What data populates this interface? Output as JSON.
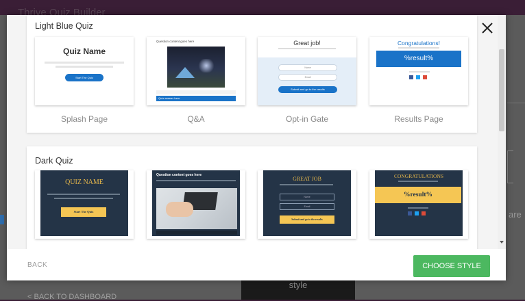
{
  "background": {
    "app_title": "Thrive Quiz Builder",
    "secondary_button": "style",
    "back_to_dashboard": "< BACK TO DASHBOARD",
    "right_partial_text": "are"
  },
  "modal": {
    "close_icon": "close-icon",
    "sections": [
      {
        "title": "Light Blue Quiz",
        "cards": [
          {
            "label": "Splash Page",
            "preview_title": "Quiz Name",
            "preview_button": "Start The Quiz"
          },
          {
            "label": "Q&A",
            "preview_question": "Question content goes here",
            "preview_answer": "Quiz answer here"
          },
          {
            "label": "Opt-in Gate",
            "preview_title": "Great job!",
            "preview_field1": "Name",
            "preview_field2": "Email",
            "preview_button": "Submit and go to the results"
          },
          {
            "label": "Results Page",
            "preview_title": "Congratulations!",
            "preview_result": "%result%"
          }
        ]
      },
      {
        "title": "Dark Quiz",
        "cards": [
          {
            "label": "",
            "preview_title": "QUIZ NAME",
            "preview_button": "Start The Quiz"
          },
          {
            "label": "",
            "preview_question": "Question content goes here",
            "preview_answer": "Quiz answer here"
          },
          {
            "label": "",
            "preview_title": "GREAT JOB",
            "preview_field1": "Name",
            "preview_field2": "Email",
            "preview_button": "Submit and go to the results"
          },
          {
            "label": "",
            "preview_title": "CONGRATULATIONS",
            "preview_result": "%result%"
          }
        ]
      }
    ],
    "footer": {
      "back_label": "BACK",
      "choose_label": "CHOOSE STYLE"
    }
  },
  "colors": {
    "accent_blue": "#1a73c8",
    "choose_green": "#4cb860",
    "dark_navy": "#243447",
    "gold": "#f5c654"
  }
}
